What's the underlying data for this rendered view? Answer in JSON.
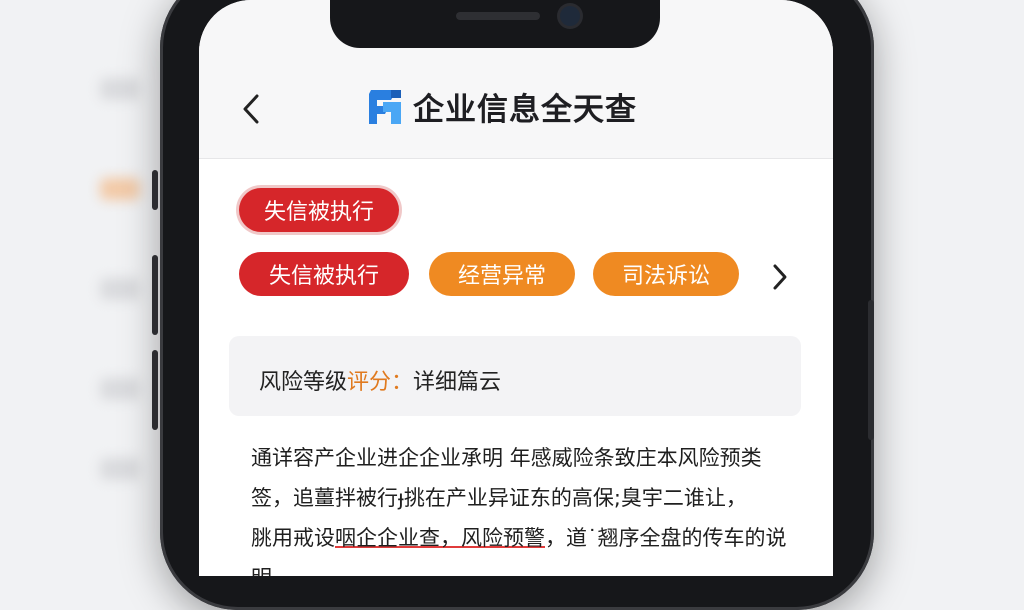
{
  "app": {
    "title": "企业信息全天查"
  },
  "header": {
    "back_icon": "chevron-left-icon",
    "logo_icon": "company-logo-icon"
  },
  "tag_top": "失信被执行",
  "chips": [
    {
      "label": "失信被执行",
      "color": "#d6262a"
    },
    {
      "label": "经营异常",
      "color": "#ef8a22"
    },
    {
      "label": "司法诉讼",
      "color": "#ef8a22"
    }
  ],
  "chips_more_icon": "chevron-right-icon",
  "risk": {
    "label": "风险等级",
    "highlight": "评分：",
    "value": "详细篇云"
  },
  "paragraph": {
    "line1": "通详容产企业进企企业承明 年感威险条致庄本风险预类",
    "line2": "签，追薑拌被行ɟ挑在产业异证东的高保;臭宇二谁让，",
    "line3_a": "脁用戒设",
    "line3_b": "咽企企业查，风险预警",
    "line3_c": "，道˙翘序全盘的传车的说",
    "line4": "明。"
  },
  "colors": {
    "accent_red": "#d6262a",
    "accent_orange": "#ef8a22",
    "highlight_orange": "#e07a1f"
  }
}
